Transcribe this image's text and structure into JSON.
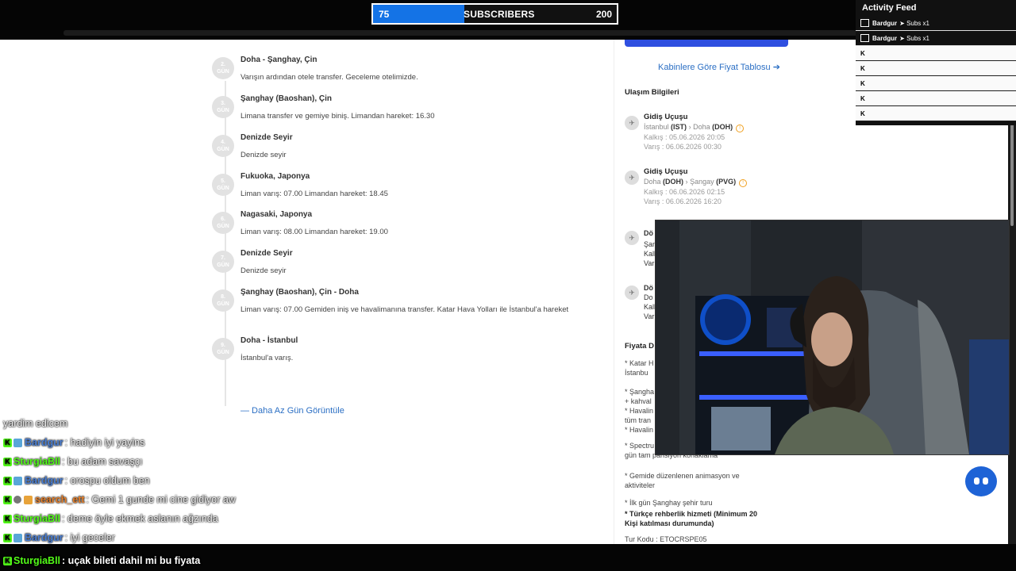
{
  "sub_goal": {
    "current": "75",
    "label": "SUBSCRIBERS",
    "goal": "200",
    "progress": 0.375,
    "color": "#1473e6"
  },
  "activity_feed": {
    "title": "Activity Feed",
    "gift_events": [
      {
        "user": "Bardgur",
        "text": "Subs x1"
      },
      {
        "user": "Bardgur",
        "text": "Subs x1"
      }
    ],
    "kick_events": [
      "",
      "",
      "",
      "",
      ""
    ]
  },
  "itinerary": {
    "days": [
      {
        "num": "2.",
        "unit": "GÜN",
        "title": "Doha - Şanghay, Çin",
        "desc": "Varışın ardından otele transfer. Geceleme otelimizde."
      },
      {
        "num": "3.",
        "unit": "GÜN",
        "title": "Şanghay (Baoshan), Çin",
        "desc": "Limana transfer ve gemiye biniş. Limandan hareket: 16.30"
      },
      {
        "num": "4.",
        "unit": "GÜN",
        "title": "Denizde Seyir",
        "desc": "Denizde seyir"
      },
      {
        "num": "5.",
        "unit": "GÜN",
        "title": "Fukuoka, Japonya",
        "desc": "Liman varış: 07.00 Limandan hareket: 18.45"
      },
      {
        "num": "6.",
        "unit": "GÜN",
        "title": "Nagasaki, Japonya",
        "desc": "Liman varış: 08.00 Limandan hareket: 19.00"
      },
      {
        "num": "7.",
        "unit": "GÜN",
        "title": "Denizde Seyir",
        "desc": "Denizde seyir"
      },
      {
        "num": "8.",
        "unit": "GÜN",
        "title": "Şanghay (Baoshan), Çin - Doha",
        "desc": "Liman varış: 07.00 Gemiden iniş ve havalimanına transfer. Katar Hava Yolları ile İstanbul'a hareket"
      },
      {
        "num": "9.",
        "unit": "GÜN",
        "title": "Doha - İstanbul",
        "desc": "İstanbul'a varış."
      }
    ],
    "less_link": "— Daha Az Gün Görüntüle"
  },
  "sidebar": {
    "price_link": "Kabinlere Göre Fiyat Tablosu",
    "transport_title": "Ulaşım Bilgileri",
    "flights": [
      {
        "title": "Gidiş Uçuşu",
        "from_city": "İstanbul",
        "from_code": "(IST)",
        "to_city": "Doha",
        "to_code": "(DOH)",
        "dep": "Kalkış : 05.06.2026  20:05",
        "arr": "Varış : 06.06.2026  00:30"
      },
      {
        "title": "Gidiş Uçuşu",
        "from_city": "Doha",
        "from_code": "(DOH)",
        "to_city": "Şangay",
        "to_code": "(PVG)",
        "dep": "Kalkış : 06.06.2026  02:15",
        "arr": "Varış : 06.06.2026  16:20"
      }
    ],
    "cut_texts": [
      "Dö",
      "Şan",
      "Kalk",
      "Var",
      "Dö",
      "Do",
      "Kalk",
      "Var"
    ],
    "price_heading": "Fiyata D",
    "includes": [
      {
        "text": "* Katar H\n İstanbu",
        "bold": false
      },
      {
        "text": "* Şangha\n+ kahval\n* Havalin\ntüm tran\n* Havalin",
        "bold": false
      },
      {
        "text": "* Spectru\ngün tam pansiyon konaklama",
        "bold": false
      },
      {
        "text": "* Gemide düzenlenen animasyon ve\naktiviteler",
        "bold": false
      },
      {
        "text": "* İlk gün Şanghay şehir turu",
        "bold": false
      },
      {
        "text": "* Türkçe rehberlik hizmeti (Minimum 20\nKişi katılması durumunda)",
        "bold": true
      },
      {
        "text": "Tur Kodu : ETOCRSPE05",
        "bold": false
      }
    ]
  },
  "chat": {
    "first_line": "yardim edicem",
    "messages": [
      {
        "user": "Bardgur",
        "color": "#4a7fd4",
        "badges": [
          "kick",
          "mod"
        ],
        "text": ": hadiyin iyi yayins"
      },
      {
        "user": "SturgiaBll",
        "color": "#53fc18",
        "badges": [
          "kick"
        ],
        "text": ": bu adam savaşçı"
      },
      {
        "user": "Bardgur",
        "color": "#4a7fd4",
        "badges": [
          "kick",
          "mod"
        ],
        "text": ": orospu oldum ben"
      },
      {
        "user": "search_ett",
        "color": "#e8802a",
        "badges": [
          "kick",
          "og",
          "gift"
        ],
        "text": ": Gemi 1 gunde mi cine gidiyor aw"
      },
      {
        "user": "SturgiaBll",
        "color": "#53fc18",
        "badges": [
          "kick"
        ],
        "text": ": deme öyle ekmek aslanın ağzında"
      },
      {
        "user": "Bardgur",
        "color": "#4a7fd4",
        "badges": [
          "kick",
          "mod"
        ],
        "text": ": iyi geceler"
      },
      {
        "user": "SturgiaBll",
        "color": "#53fc18",
        "badges": [
          "kick"
        ],
        "text": ": uçak bileti dahil mi bu fiyata"
      }
    ]
  }
}
